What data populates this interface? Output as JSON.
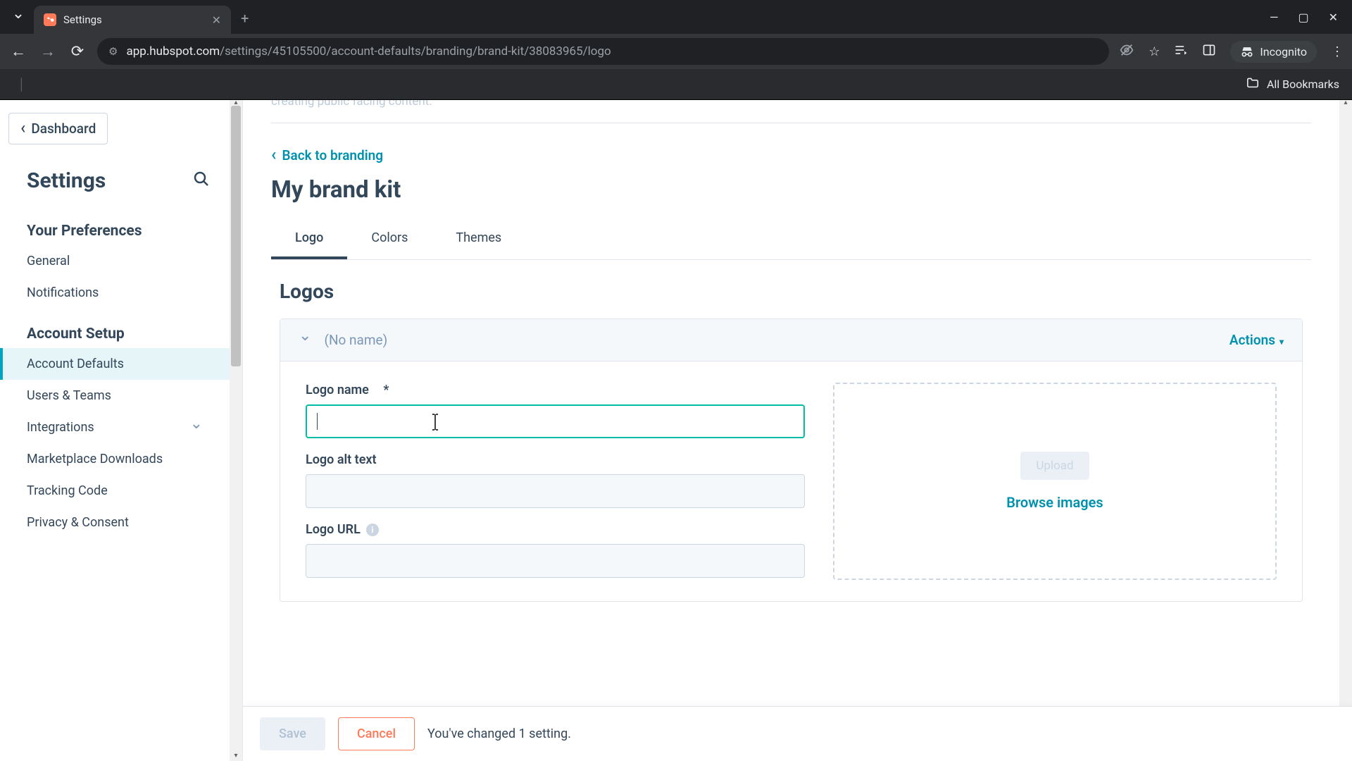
{
  "browser": {
    "tab_title": "Settings",
    "url_display_prefix": "app.hubspot.com",
    "url_display_path": "/settings/45105500/account-defaults/branding/brand-kit/38083965/logo",
    "incognito_label": "Incognito",
    "bookmarks_label": "All Bookmarks"
  },
  "sidebar": {
    "dashboard_link": "Dashboard",
    "settings_title": "Settings",
    "section_prefs": "Your Preferences",
    "items_prefs": [
      "General",
      "Notifications"
    ],
    "section_account": "Account Setup",
    "items_account": [
      "Account Defaults",
      "Users & Teams",
      "Integrations",
      "Marketplace Downloads",
      "Tracking Code",
      "Privacy & Consent"
    ]
  },
  "main": {
    "truncated_hint": "creating public facing content.",
    "back_link": "Back to branding",
    "page_title": "My brand kit",
    "tabs": [
      "Logo",
      "Colors",
      "Themes"
    ],
    "section_title": "Logos",
    "card_header_name": "(No name)",
    "actions_label": "Actions",
    "fields": {
      "logo_name_label": "Logo name",
      "logo_name_required": "*",
      "logo_alt_label": "Logo alt text",
      "logo_url_label": "Logo URL",
      "logo_name_value": "",
      "logo_alt_value": "",
      "logo_url_value": ""
    },
    "upload": {
      "upload_btn": "Upload",
      "browse_link": "Browse images"
    }
  },
  "savebar": {
    "save": "Save",
    "cancel": "Cancel",
    "message": "You've changed 1 setting."
  }
}
